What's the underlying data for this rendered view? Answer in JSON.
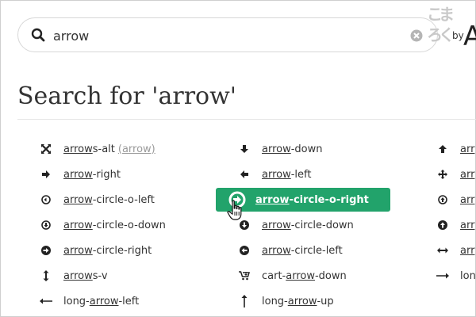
{
  "search": {
    "value": "arrow",
    "placeholder": ""
  },
  "header": {
    "brand_chars": [
      "こ",
      "ま",
      "ろ",
      "く"
    ],
    "by": "by",
    "big_letter": "A"
  },
  "page": {
    "title": "Search for 'arrow'"
  },
  "results": [
    {
      "icon": "arrows-alt-icon",
      "pre": "",
      "hl": "arrow",
      "post": "s-alt",
      "alias": "(arrow)"
    },
    {
      "icon": "arrow-down-icon",
      "pre": "",
      "hl": "arrow",
      "post": "-down"
    },
    {
      "icon": "arrow-up-icon",
      "pre": "",
      "hl": "arr",
      "post": ""
    },
    {
      "icon": "arrow-right-icon",
      "pre": "",
      "hl": "arrow",
      "post": "-right"
    },
    {
      "icon": "arrow-left-icon",
      "pre": "",
      "hl": "arrow",
      "post": "-left"
    },
    {
      "icon": "arrows-icon",
      "pre": "",
      "hl": "arr",
      "post": ""
    },
    {
      "icon": "arrow-circle-o-left-icon",
      "pre": "",
      "hl": "arrow",
      "post": "-circle-o-left"
    },
    {
      "icon": "arrow-circle-o-right-icon",
      "pre": "",
      "hl": "arrow",
      "post": "-circle-o-right",
      "selected": true
    },
    {
      "icon": "arrow-circle-o-up-icon",
      "pre": "",
      "hl": "arr",
      "post": ""
    },
    {
      "icon": "arrow-circle-o-down-icon",
      "pre": "",
      "hl": "arrow",
      "post": "-circle-o-down"
    },
    {
      "icon": "arrow-circle-down-icon",
      "pre": "",
      "hl": "arrow",
      "post": "-circle-down"
    },
    {
      "icon": "arrow-circle-up-icon",
      "pre": "",
      "hl": "arr",
      "post": ""
    },
    {
      "icon": "arrow-circle-right-icon",
      "pre": "",
      "hl": "arrow",
      "post": "-circle-right"
    },
    {
      "icon": "arrow-circle-left-icon",
      "pre": "",
      "hl": "arrow",
      "post": "-circle-left"
    },
    {
      "icon": "arrows-h-icon",
      "pre": "",
      "hl": "arr",
      "post": ""
    },
    {
      "icon": "arrows-v-icon",
      "pre": "",
      "hl": "arrow",
      "post": "s-v"
    },
    {
      "icon": "cart-arrow-down-icon",
      "pre": "cart-",
      "hl": "arrow",
      "post": "-down"
    },
    {
      "icon": "long-arrow-right-icon",
      "pre": "long",
      "hl": "",
      "post": ""
    },
    {
      "icon": "long-arrow-left-icon",
      "pre": "long-",
      "hl": "arrow",
      "post": "-left"
    },
    {
      "icon": "long-arrow-up-icon",
      "pre": "long-",
      "hl": "arrow",
      "post": "-up"
    }
  ],
  "colors": {
    "accent": "#22a36b",
    "text": "#333333",
    "muted": "#9a9a9a",
    "border": "#d7d7d7"
  }
}
